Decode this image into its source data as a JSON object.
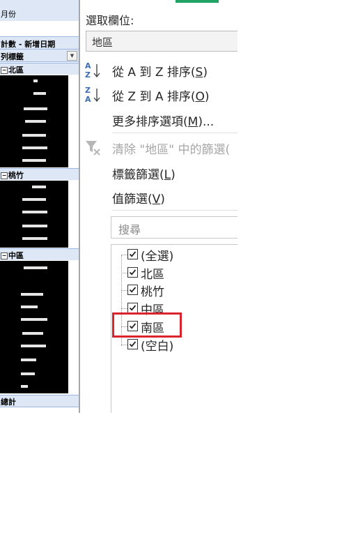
{
  "pivot": {
    "month_header": "月份",
    "count_header": "計數 - 新增日期",
    "row_labels_header": "列標籤",
    "groups": [
      {
        "label": "北區",
        "toggle": "⊟"
      },
      {
        "label": "桃竹",
        "toggle": "⊟"
      },
      {
        "label": "中區",
        "toggle": "⊟"
      }
    ],
    "total_label": "總計"
  },
  "menu": {
    "select_field_label": "選取欄位:",
    "select_field_value": "地區",
    "sort_az": {
      "text": "從 A 到 Z 排序(",
      "key": "S",
      "end": ")",
      "icon": "sort-a-to-z-icon"
    },
    "sort_za": {
      "text": "從 Z 到 A 排序(",
      "key": "O",
      "end": ")",
      "icon": "sort-z-to-a-icon"
    },
    "more_sort": {
      "text": "更多排序選項(",
      "key": "M",
      "end": ")..."
    },
    "clear_filter": {
      "text": "清除 \"地區\" 中的篩選(",
      "icon": "clear-filter-icon"
    },
    "label_filter": {
      "text": "標籤篩選(",
      "key": "L",
      "end": ")"
    },
    "value_filter": {
      "text": "值篩選(",
      "key": "V",
      "end": ")"
    },
    "search_placeholder": "搜尋",
    "items": [
      {
        "label": "(全選)",
        "checked": true
      },
      {
        "label": "北區",
        "checked": true
      },
      {
        "label": "桃竹",
        "checked": true
      },
      {
        "label": "中區",
        "checked": true
      },
      {
        "label": "南區",
        "checked": true
      },
      {
        "label": "(空白)",
        "checked": true
      }
    ]
  },
  "colors": {
    "highlight": "#d9232d",
    "header_blue": "#dde7f5",
    "excel_green": "#21a366"
  }
}
